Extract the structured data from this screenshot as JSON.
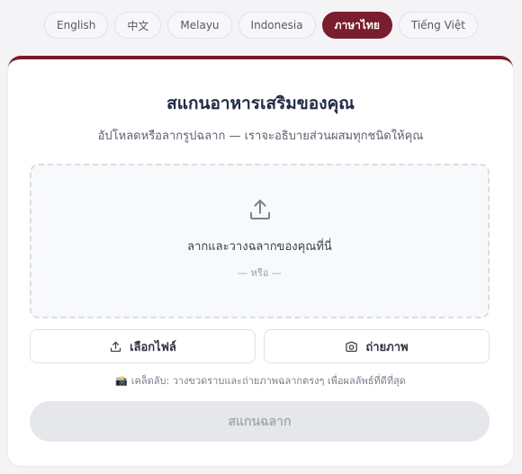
{
  "languages": [
    {
      "label": "English",
      "active": false
    },
    {
      "label": "中文",
      "active": false
    },
    {
      "label": "Melayu",
      "active": false
    },
    {
      "label": "Indonesia",
      "active": false
    },
    {
      "label": "ภาษาไทย",
      "active": true
    },
    {
      "label": "Tiếng Việt",
      "active": false
    }
  ],
  "header": {
    "title": "สแกนอาหารเสริมของคุณ",
    "subtitle": "อัปโหลดหรือลากรูปฉลาก — เราจะอธิบายส่วนผสมทุกชนิดให้คุณ"
  },
  "dropzone": {
    "icon": "upload-icon",
    "text": "ลากและวางฉลากของคุณที่นี่",
    "or": "— หรือ —"
  },
  "buttons": {
    "choose_file": "เลือกไฟล์",
    "choose_file_icon": "upload-icon",
    "take_photo": "ถ่ายภาพ",
    "take_photo_icon": "camera-icon"
  },
  "tip": {
    "emoji": "📸",
    "text": "เคล็ดลับ: วางขวดราบและถ่ายภาพฉลากตรงๆ เพื่อผลลัพธ์ที่ดีที่สุด"
  },
  "scan_button": {
    "label": "สแกนฉลาก",
    "disabled": true
  },
  "colors": {
    "accent": "#7a1d2e",
    "title": "#1f2a44",
    "disabled_bg": "#e6e7ea"
  }
}
